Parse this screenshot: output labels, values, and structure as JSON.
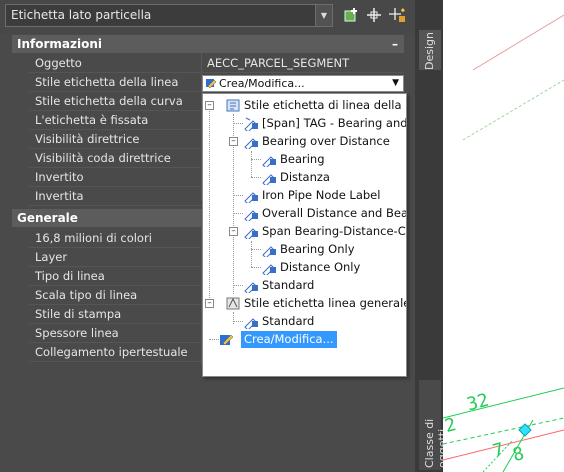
{
  "selector": {
    "value": "Etichetta lato particella"
  },
  "toolbar": {
    "icons": [
      "add-selection-icon",
      "select-objects-icon",
      "quick-select-icon"
    ]
  },
  "categories": [
    {
      "name": "Informazioni",
      "toggle": "–"
    },
    {
      "name": "Generale",
      "toggle": ""
    }
  ],
  "info_rows": [
    {
      "label": "Oggetto",
      "value": "AECC_PARCEL_SEGMENT"
    },
    {
      "label": "Stile etichetta della linea",
      "value": "Crea/Modifica..."
    },
    {
      "label": "Stile etichetta della curva",
      "value": ""
    },
    {
      "label": "L'etichetta è fissata",
      "value": ""
    },
    {
      "label": "Visibilità direttrice",
      "value": ""
    },
    {
      "label": "Visibilità coda direttrice",
      "value": ""
    },
    {
      "label": "Invertito",
      "value": ""
    },
    {
      "label": "Invertita",
      "value": ""
    }
  ],
  "general_rows": [
    {
      "label": "16,8 milioni di colori"
    },
    {
      "label": "Layer"
    },
    {
      "label": "Tipo di linea"
    },
    {
      "label": "Scala tipo di linea"
    },
    {
      "label": "Stile di stampa"
    },
    {
      "label": "Spessore linea"
    },
    {
      "label": "Collegamento ipertestuale"
    }
  ],
  "tree": {
    "root1": "Stile etichetta di linea della particella",
    "span_tag": "[Span] TAG - Bearing and Distance with Crows Feet",
    "bearing_over_distance": "Bearing over Distance",
    "bearing": "Bearing",
    "distanza": "Distanza",
    "iron_pipe": "Iron Pipe Node Label",
    "overall": "Overall Distance and Bearing",
    "span_bearing": "Span Bearing-Distance-Crows Feet",
    "bearing_only": "Bearing Only",
    "distance_only": "Distance Only",
    "standard1": "Standard",
    "root2": "Stile etichetta linea generale",
    "standard2": "Standard",
    "crea": "Crea/Modifica..."
  },
  "side_tabs": {
    "design": "Design",
    "classe": "Classe di oggetti"
  },
  "drawing_text": [
    "2",
    "32",
    "7",
    "8"
  ],
  "colors": {
    "panel": "#4a4a4a",
    "selected": "#3399ff",
    "drawing_green": "#22cc55",
    "marker_cyan": "#33e0ff"
  }
}
